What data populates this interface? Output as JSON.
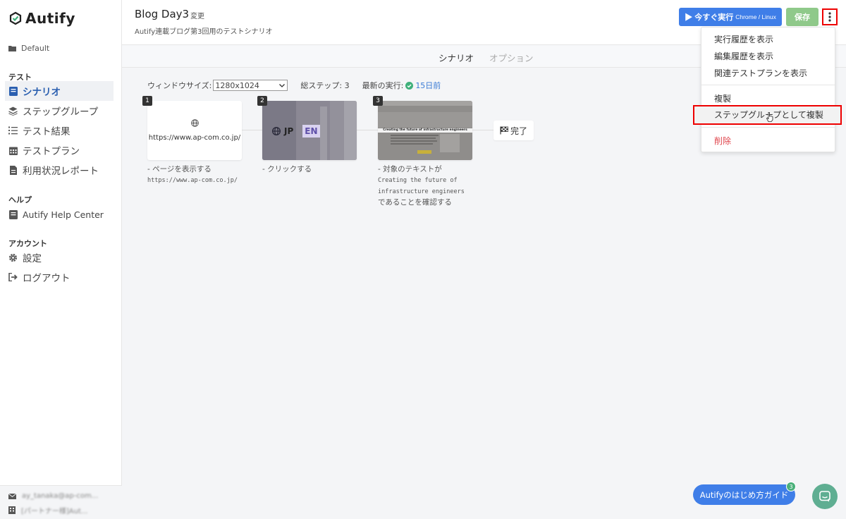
{
  "sidebar": {
    "logo_text": "Autify",
    "workspace": "Default",
    "sections": {
      "test": "テスト",
      "help": "ヘルプ",
      "account": "アカウント"
    },
    "nav": {
      "scenario": "シナリオ",
      "step_group": "ステップグループ",
      "test_results": "テスト結果",
      "test_plan": "テストプラン",
      "usage_report": "利用状況レポート",
      "help_center": "Autify Help Center",
      "settings": "設定",
      "logout": "ログアウト"
    },
    "footer": {
      "email": "ay_tanaka@ap-com...",
      "org": "[パートナー様]Aut..."
    }
  },
  "header": {
    "title": "Blog Day3",
    "change_link": "変更",
    "subtitle": "Autify連載ブログ第3回用のテストシナリオ",
    "run_label": "▶ 今すぐ実行",
    "run_env": "Chrome / Linux",
    "save_label": "保存"
  },
  "tabs": {
    "scenario": "シナリオ",
    "options": "オプション"
  },
  "info": {
    "window_size_label": "ウィンドウサイズ:",
    "window_size_value": "1280x1024",
    "total_steps": "総ステップ: 3",
    "last_run_label": "最新の実行:",
    "last_run_value": "15日前"
  },
  "steps": [
    {
      "num": "1",
      "card_url": "https://www.ap-com.co.jp/",
      "desc_prefix": "- ページを表示する",
      "desc_code": "https://www.ap-com.co.jp/"
    },
    {
      "num": "2",
      "card_jp": "JP",
      "card_en": "EN",
      "desc_prefix": "- クリックする"
    },
    {
      "num": "3",
      "card_headline": "Creating the future of infrastructure engineers",
      "desc_prefix": "- 対象のテキストが",
      "desc_code": "Creating the future of infrastructure engineers",
      "desc_suffix": "であることを確認する"
    }
  ],
  "done_label": "完了",
  "dropdown": {
    "items": {
      "run_history": "実行履歴を表示",
      "edit_history": "編集履歴を表示",
      "related_plans": "関連テストプランを表示",
      "duplicate": "複製",
      "duplicate_as_group": "ステップグループとして複製",
      "delete": "削除"
    }
  },
  "guide": {
    "label": "Autifyのはじめ方ガイド",
    "badge": "3"
  },
  "colors": {
    "primary": "#3f7ee8",
    "save": "#8fc98a",
    "danger": "#e0464d",
    "highlight_border": "#ee0000",
    "chat": "#5fae92"
  }
}
